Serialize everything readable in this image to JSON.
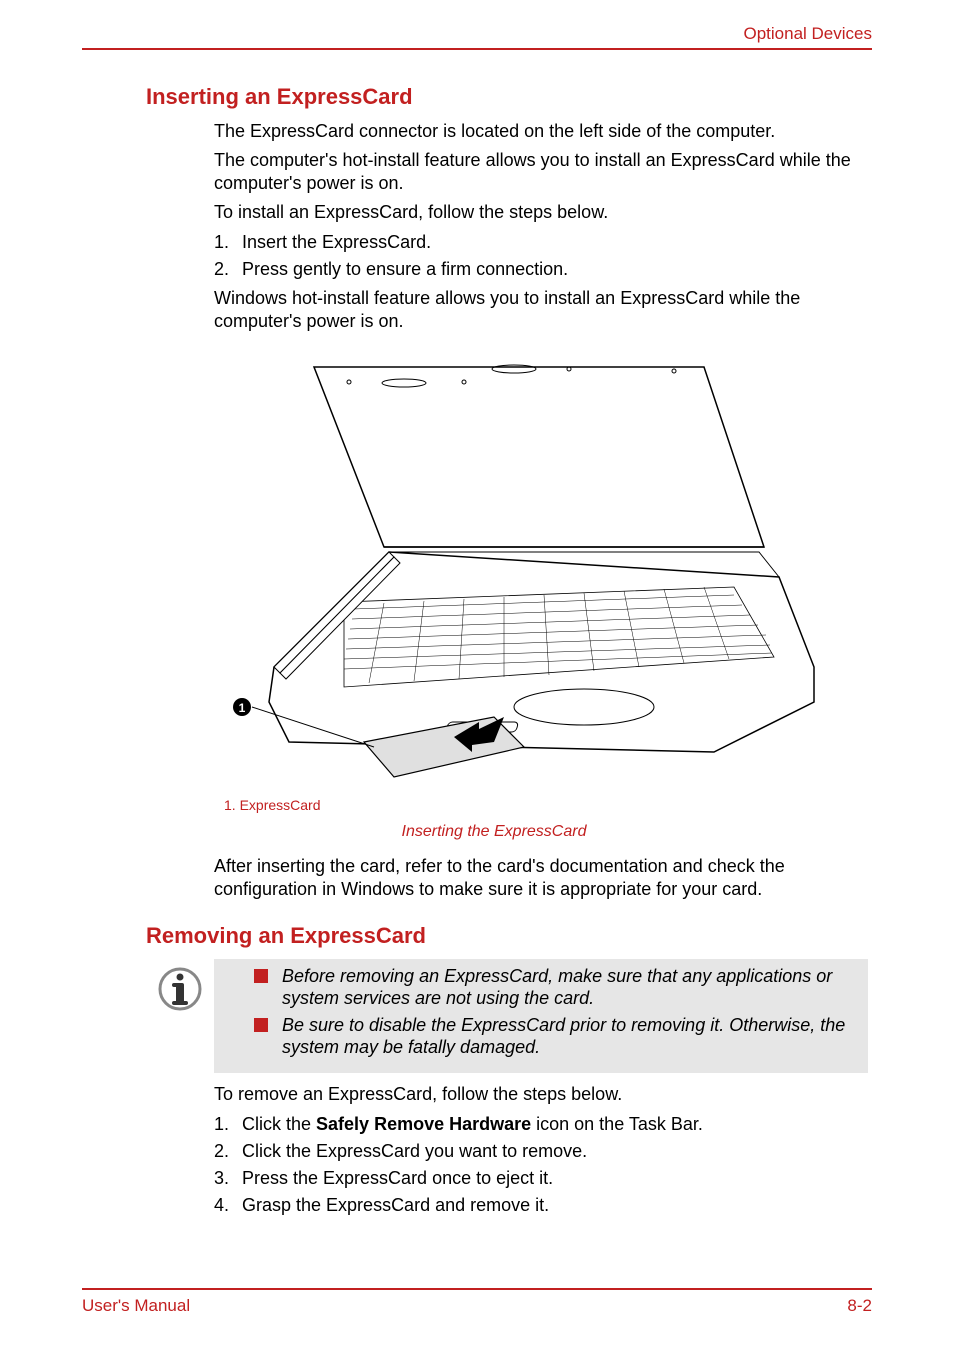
{
  "header": {
    "right": "Optional Devices"
  },
  "section1": {
    "heading": "Inserting an ExpressCard",
    "p1": "The ExpressCard connector is located on the left side of the computer.",
    "p2": "The computer's hot-install feature allows you to install an ExpressCard while the computer's power is on.",
    "p3": "To install an ExpressCard, follow the steps below.",
    "steps": [
      {
        "n": "1.",
        "t": "Insert the ExpressCard."
      },
      {
        "n": "2.",
        "t": "Press gently to ensure a firm connection."
      }
    ],
    "p4": "Windows hot-install feature allows you to install an ExpressCard while the computer's power is on.",
    "fig_legend": "1. ExpressCard",
    "fig_caption": "Inserting the ExpressCard",
    "p5": "After inserting the card, refer to the card's documentation and check the configuration in Windows to make sure it is appropriate for your card."
  },
  "section2": {
    "heading": "Removing an ExpressCard",
    "notes": [
      "Before removing an ExpressCard, make sure that any applications or system services are not using the card.",
      "Be sure to disable the ExpressCard prior to removing it. Otherwise, the system may be fatally damaged."
    ],
    "p1": "To remove an ExpressCard, follow the steps below.",
    "steps": [
      {
        "n": "1.",
        "pre": "Click the ",
        "bold": "Safely Remove Hardware",
        "post": " icon on the Task Bar."
      },
      {
        "n": "2.",
        "pre": "Click the ExpressCard you want to remove.",
        "bold": "",
        "post": ""
      },
      {
        "n": "3.",
        "pre": "Press the ExpressCard once to eject it.",
        "bold": "",
        "post": ""
      },
      {
        "n": "4.",
        "pre": "Grasp the ExpressCard and remove it.",
        "bold": "",
        "post": ""
      }
    ]
  },
  "footer": {
    "left": "User's Manual",
    "right": "8-2"
  }
}
